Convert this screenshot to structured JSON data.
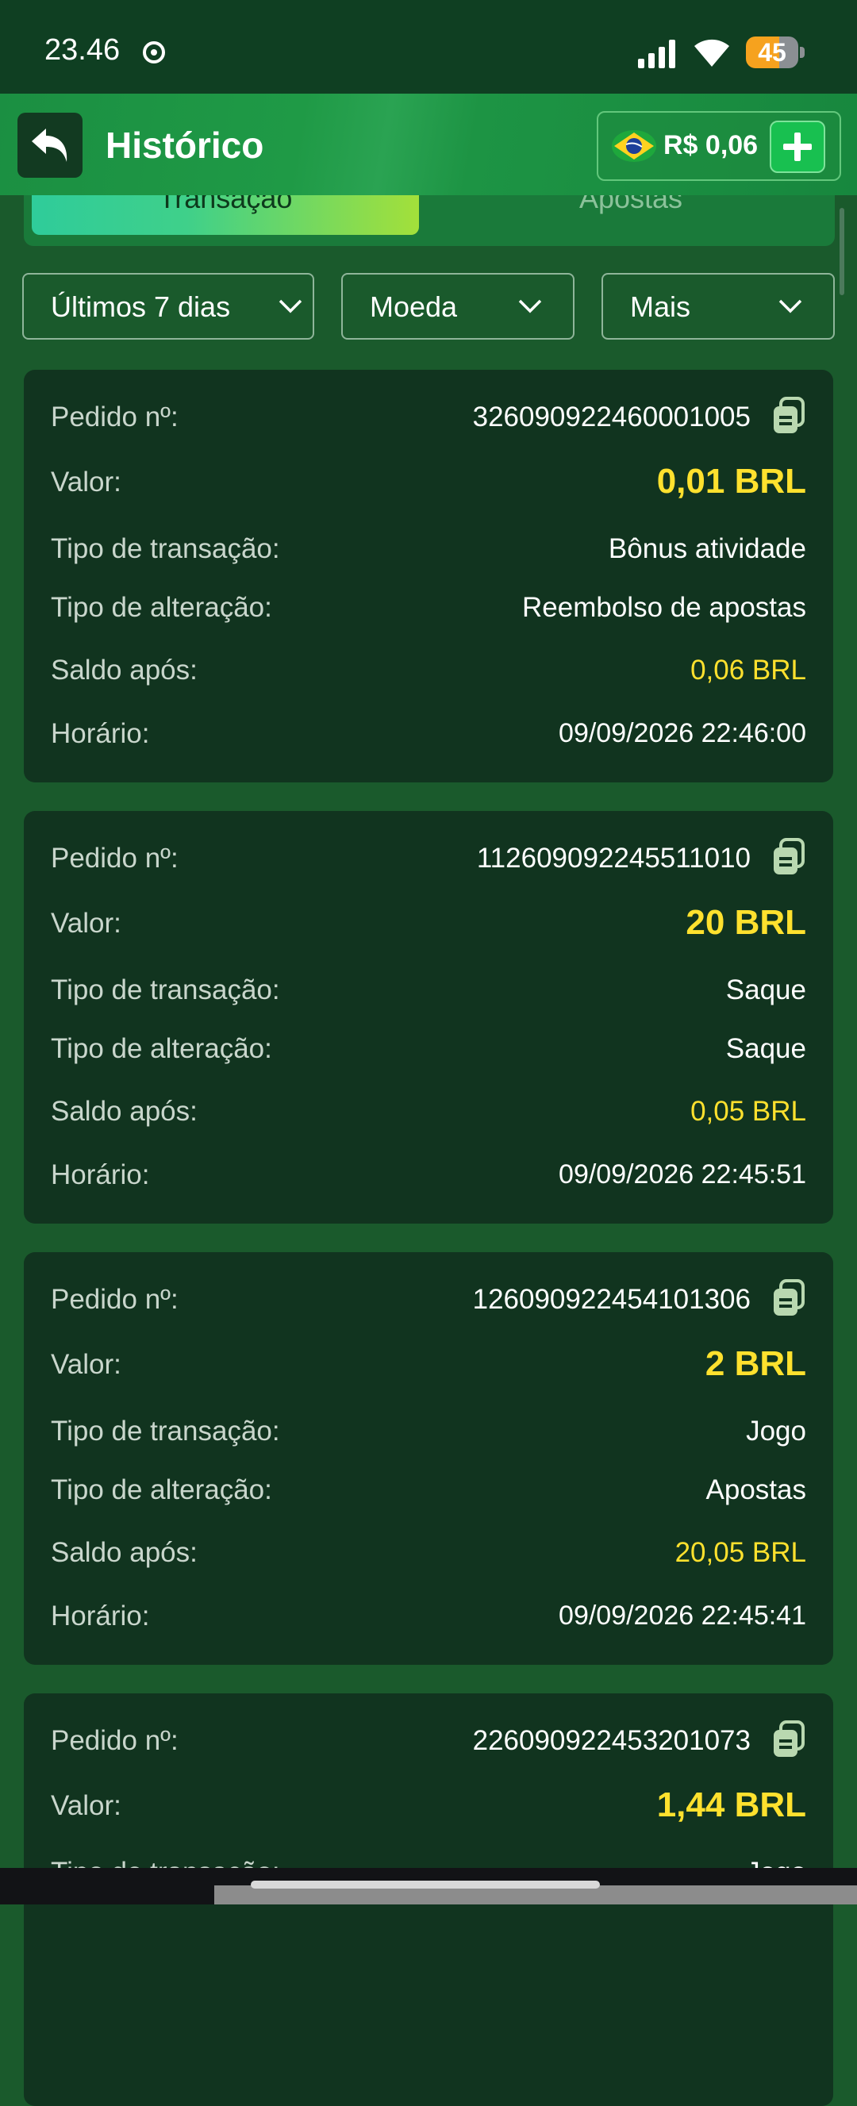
{
  "status": {
    "time": "23.46",
    "battery": "45"
  },
  "header": {
    "title": "Histórico",
    "balance": "R$ 0,06"
  },
  "tabs": [
    {
      "label": "Transação"
    },
    {
      "label": "Apostas"
    }
  ],
  "filters": [
    {
      "label": "Últimos 7 dias"
    },
    {
      "label": "Moeda"
    },
    {
      "label": "Mais"
    }
  ],
  "labels": {
    "order": "Pedido nº:",
    "value": "Valor:",
    "transaction_type": "Tipo de transação:",
    "change_type": "Tipo de alteração:",
    "balance_after": "Saldo após:",
    "time": "Horário:"
  },
  "transactions": [
    {
      "order": "326090922460001005",
      "value": "0,01 BRL",
      "transaction_type": "Bônus atividade",
      "change_type": "Reembolso de apostas",
      "balance_after": "0,06 BRL",
      "time": "09/09/2026 22:46:00"
    },
    {
      "order": "112609092245511010",
      "value": "20 BRL",
      "transaction_type": "Saque",
      "change_type": "Saque",
      "balance_after": "0,05 BRL",
      "time": "09/09/2026 22:45:51"
    },
    {
      "order": "126090922454101306",
      "value": "2 BRL",
      "transaction_type": "Jogo",
      "change_type": "Apostas",
      "balance_after": "20,05 BRL",
      "time": "09/09/2026 22:45:41"
    },
    {
      "order": "226090922453201073",
      "value": "1,44 BRL",
      "transaction_type": "Jogo"
    }
  ]
}
